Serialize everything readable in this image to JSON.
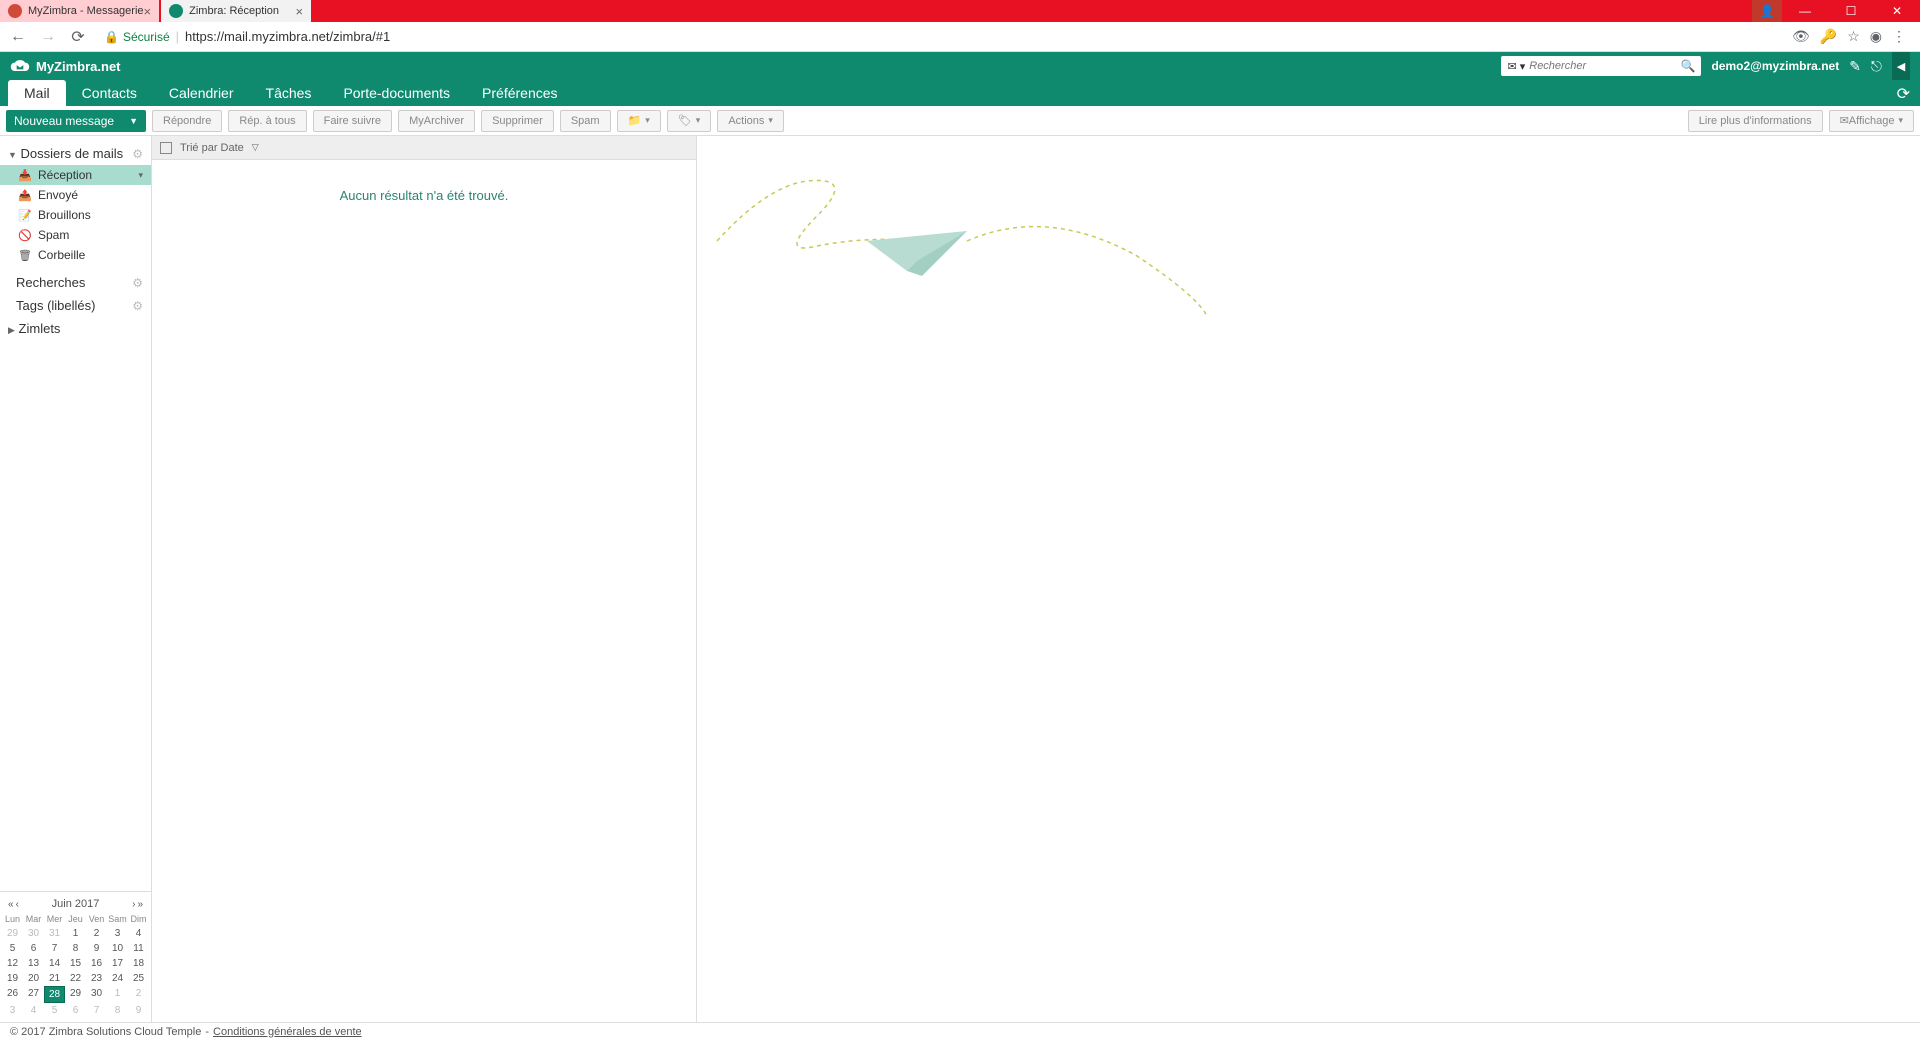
{
  "browser": {
    "tabs": [
      {
        "title": "MyZimbra - Messagerie",
        "active": false
      },
      {
        "title": "Zimbra: Réception",
        "active": true
      }
    ],
    "url_secure_label": "Sécurisé",
    "url": "https://mail.myzimbra.net/zimbra/#1"
  },
  "header": {
    "brand": "MyZimbra.net",
    "search_placeholder": "Rechercher",
    "user_email": "demo2@myzimbra.net"
  },
  "nav_tabs": [
    "Mail",
    "Contacts",
    "Calendrier",
    "Tâches",
    "Porte-documents",
    "Préférences"
  ],
  "toolbar": {
    "new_message": "Nouveau message",
    "reply": "Répondre",
    "reply_all": "Rép. à tous",
    "forward": "Faire suivre",
    "archive": "MyArchiver",
    "delete": "Supprimer",
    "spam": "Spam",
    "actions": "Actions",
    "read_more": "Lire plus d'informations",
    "display": "Affichage"
  },
  "sidebar": {
    "folders_header": "Dossiers de mails",
    "folders": [
      {
        "label": "Réception",
        "active": true
      },
      {
        "label": "Envoyé"
      },
      {
        "label": "Brouillons"
      },
      {
        "label": "Spam"
      },
      {
        "label": "Corbeille"
      }
    ],
    "searches_header": "Recherches",
    "tags_header": "Tags (libellés)",
    "zimlets_header": "Zimlets"
  },
  "msg_list": {
    "sort_label": "Trié par Date",
    "no_results": "Aucun résultat n'a été trouvé."
  },
  "calendar": {
    "month_label": "Juin 2017",
    "dow": [
      "Lun",
      "Mar",
      "Mer",
      "Jeu",
      "Ven",
      "Sam",
      "Dim"
    ],
    "weeks": [
      [
        {
          "d": "29",
          "dim": true
        },
        {
          "d": "30",
          "dim": true
        },
        {
          "d": "31",
          "dim": true
        },
        {
          "d": "1"
        },
        {
          "d": "2"
        },
        {
          "d": "3"
        },
        {
          "d": "4"
        }
      ],
      [
        {
          "d": "5"
        },
        {
          "d": "6"
        },
        {
          "d": "7"
        },
        {
          "d": "8"
        },
        {
          "d": "9"
        },
        {
          "d": "10"
        },
        {
          "d": "11"
        }
      ],
      [
        {
          "d": "12"
        },
        {
          "d": "13"
        },
        {
          "d": "14"
        },
        {
          "d": "15"
        },
        {
          "d": "16"
        },
        {
          "d": "17"
        },
        {
          "d": "18"
        }
      ],
      [
        {
          "d": "19"
        },
        {
          "d": "20"
        },
        {
          "d": "21"
        },
        {
          "d": "22"
        },
        {
          "d": "23"
        },
        {
          "d": "24"
        },
        {
          "d": "25"
        }
      ],
      [
        {
          "d": "26"
        },
        {
          "d": "27"
        },
        {
          "d": "28",
          "today": true
        },
        {
          "d": "29"
        },
        {
          "d": "30"
        },
        {
          "d": "1",
          "dim": true
        },
        {
          "d": "2",
          "dim": true
        }
      ],
      [
        {
          "d": "3",
          "dim": true
        },
        {
          "d": "4",
          "dim": true
        },
        {
          "d": "5",
          "dim": true
        },
        {
          "d": "6",
          "dim": true
        },
        {
          "d": "7",
          "dim": true
        },
        {
          "d": "8",
          "dim": true
        },
        {
          "d": "9",
          "dim": true
        }
      ]
    ]
  },
  "footer": {
    "copyright": "© 2017 Zimbra Solutions Cloud Temple",
    "sep": " - ",
    "terms": "Conditions générales de vente"
  }
}
